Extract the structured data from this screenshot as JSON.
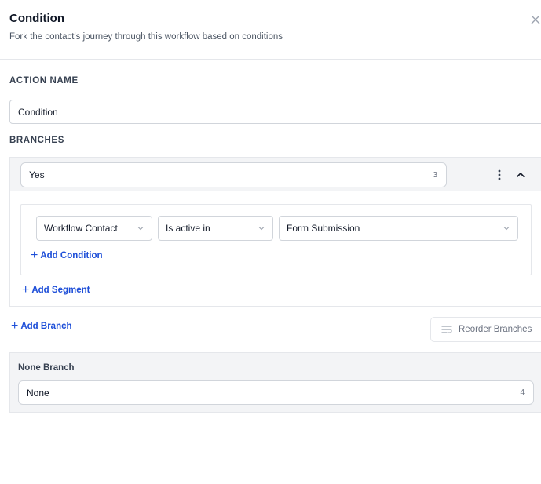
{
  "panel": {
    "title": "Condition",
    "subtitle": "Fork the contact's journey through this workflow based on conditions"
  },
  "action_name": {
    "label": "ACTION NAME",
    "value": "Condition"
  },
  "branches": {
    "label": "BRANCHES",
    "items": [
      {
        "name": "Yes",
        "count": "3",
        "conditions": [
          {
            "field": "Workflow Contact",
            "operator": "Is active in",
            "value": "Form Submission"
          }
        ],
        "add_condition_label": "Add Condition",
        "add_segment_label": "Add Segment"
      }
    ],
    "add_branch_label": "Add Branch",
    "reorder_label": "Reorder Branches"
  },
  "none_branch": {
    "label": "None Branch",
    "value": "None",
    "count": "4"
  },
  "icons": {
    "close": "close-icon",
    "more": "more-vertical-icon",
    "collapse": "chevron-up-icon",
    "dropdown": "chevron-down-icon",
    "add": "plus-icon",
    "reorder": "reorder-list-icon"
  },
  "colors": {
    "link": "#1d4ed8",
    "section_bg": "#f3f4f6",
    "border": "#d1d5db"
  }
}
